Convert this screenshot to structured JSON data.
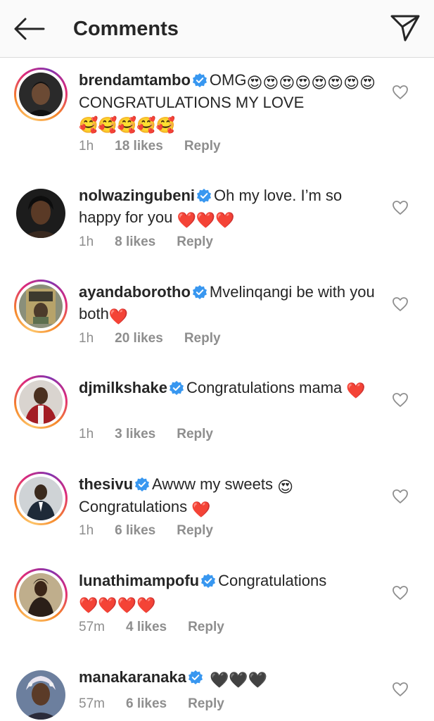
{
  "header": {
    "title": "Comments",
    "back_icon": "arrow-left-icon",
    "send_icon": "paper-plane-icon"
  },
  "colors": {
    "verified": "#3897f0",
    "heart_red": "#e0245e",
    "meta_gray": "#8e8e8e"
  },
  "comments": [
    {
      "username": "brendamtambo",
      "text_before": "OMG",
      "emojis_mid": "😍😍😍😍😍😍😍😍",
      "text": "CONGRATULATIONS MY LOVE",
      "emojis_end": "🥰🥰🥰🥰🥰",
      "time": "1h",
      "likes": "18 likes",
      "reply": "Reply"
    },
    {
      "username": "nolwazingubeni",
      "text": "Oh my love. I’m so happy for you",
      "emojis_end": "❤️❤️❤️",
      "time": "1h",
      "likes": "8 likes",
      "reply": "Reply"
    },
    {
      "username": "ayandaborotho",
      "text": "Mvelinqangi be with you both",
      "emojis_end": "❤️",
      "time": "1h",
      "likes": "20 likes",
      "reply": "Reply"
    },
    {
      "username": "djmilkshake",
      "text": "Congratulations mama",
      "emojis_end": "❤️",
      "time": "1h",
      "likes": "3 likes",
      "reply": "Reply"
    },
    {
      "username": "thesivu",
      "text": "Awww my sweets",
      "emoji_mid": "😍",
      "text2": "Congratulations",
      "emojis_end": "❤️",
      "time": "1h",
      "likes": "6 likes",
      "reply": "Reply"
    },
    {
      "username": "lunathimampofu",
      "text": "Congratulations",
      "emojis_end": "❤️❤️❤️❤️",
      "time": "57m",
      "likes": "4 likes",
      "reply": "Reply"
    },
    {
      "username": "manakaranaka",
      "emojis_end": "🖤🖤🖤",
      "time": "57m",
      "likes": "6 likes",
      "reply": "Reply"
    }
  ]
}
